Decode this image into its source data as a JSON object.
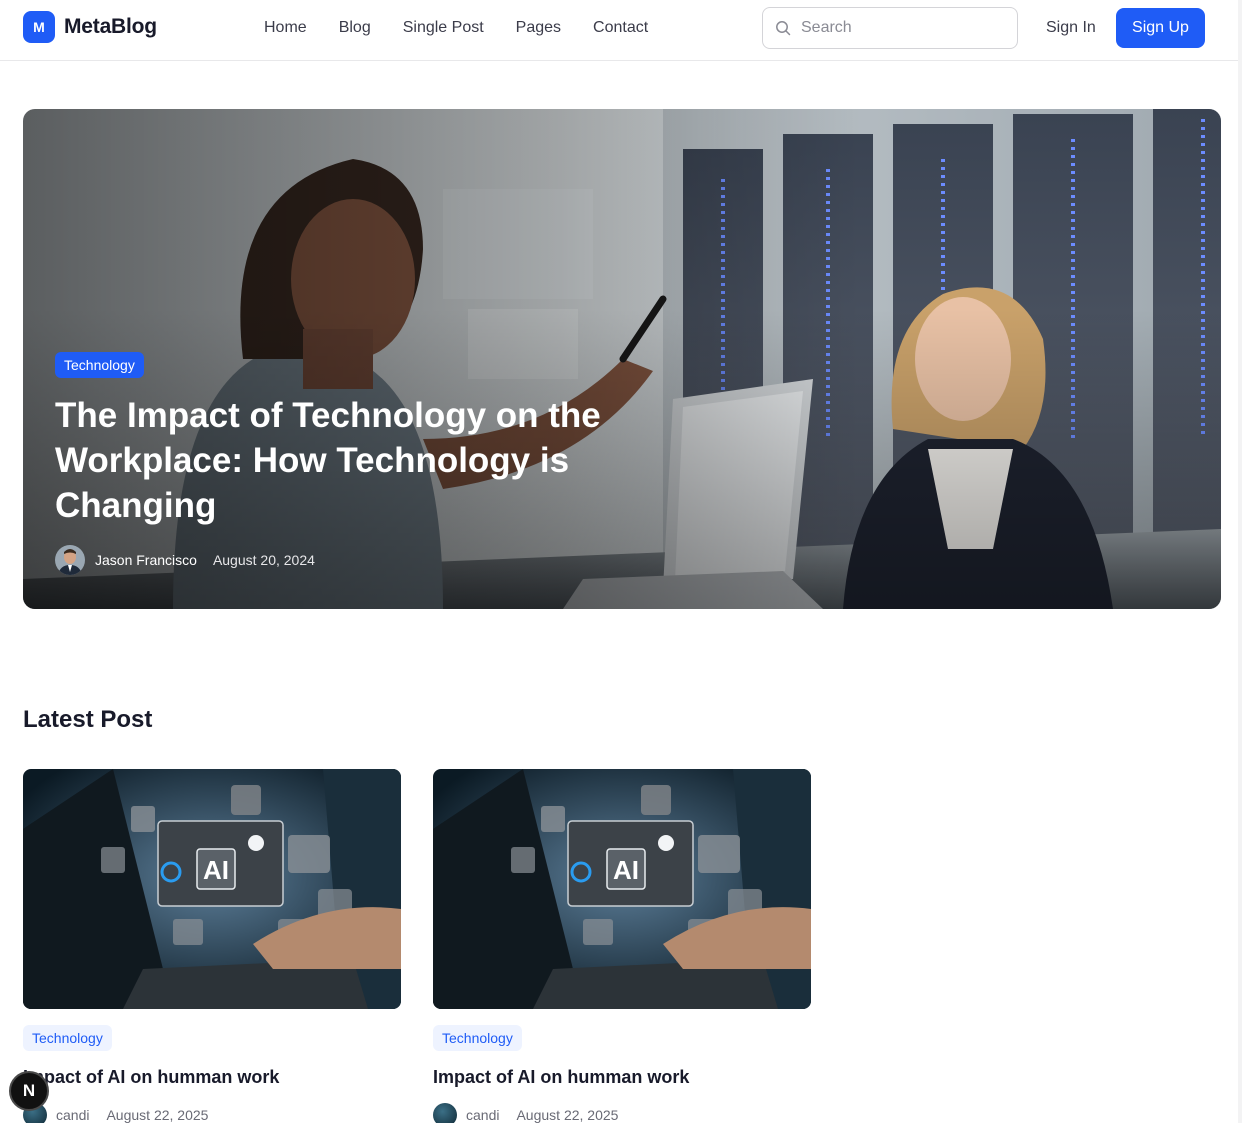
{
  "brand": {
    "mark": "M",
    "name": "MetaBlog",
    "accent": "#1f5cf6"
  },
  "nav": [
    "Home",
    "Blog",
    "Single Post",
    "Pages",
    "Contact"
  ],
  "search": {
    "placeholder": "Search"
  },
  "auth": {
    "signin": "Sign In",
    "signup": "Sign Up"
  },
  "hero": {
    "category": "Technology",
    "title": "The Impact of Technology on the Workplace: How Technology is Changing",
    "author": "Jason Francisco",
    "date": "August 20, 2024"
  },
  "latest": {
    "heading": "Latest Post",
    "posts": [
      {
        "category": "Technology",
        "title": "Impact of AI on humman work",
        "author": "candi",
        "date": "August 22, 2025"
      },
      {
        "category": "Technology",
        "title": "Impact of AI on humman work",
        "author": "candi",
        "date": "August 22, 2025"
      }
    ]
  },
  "dev_badge": "N"
}
